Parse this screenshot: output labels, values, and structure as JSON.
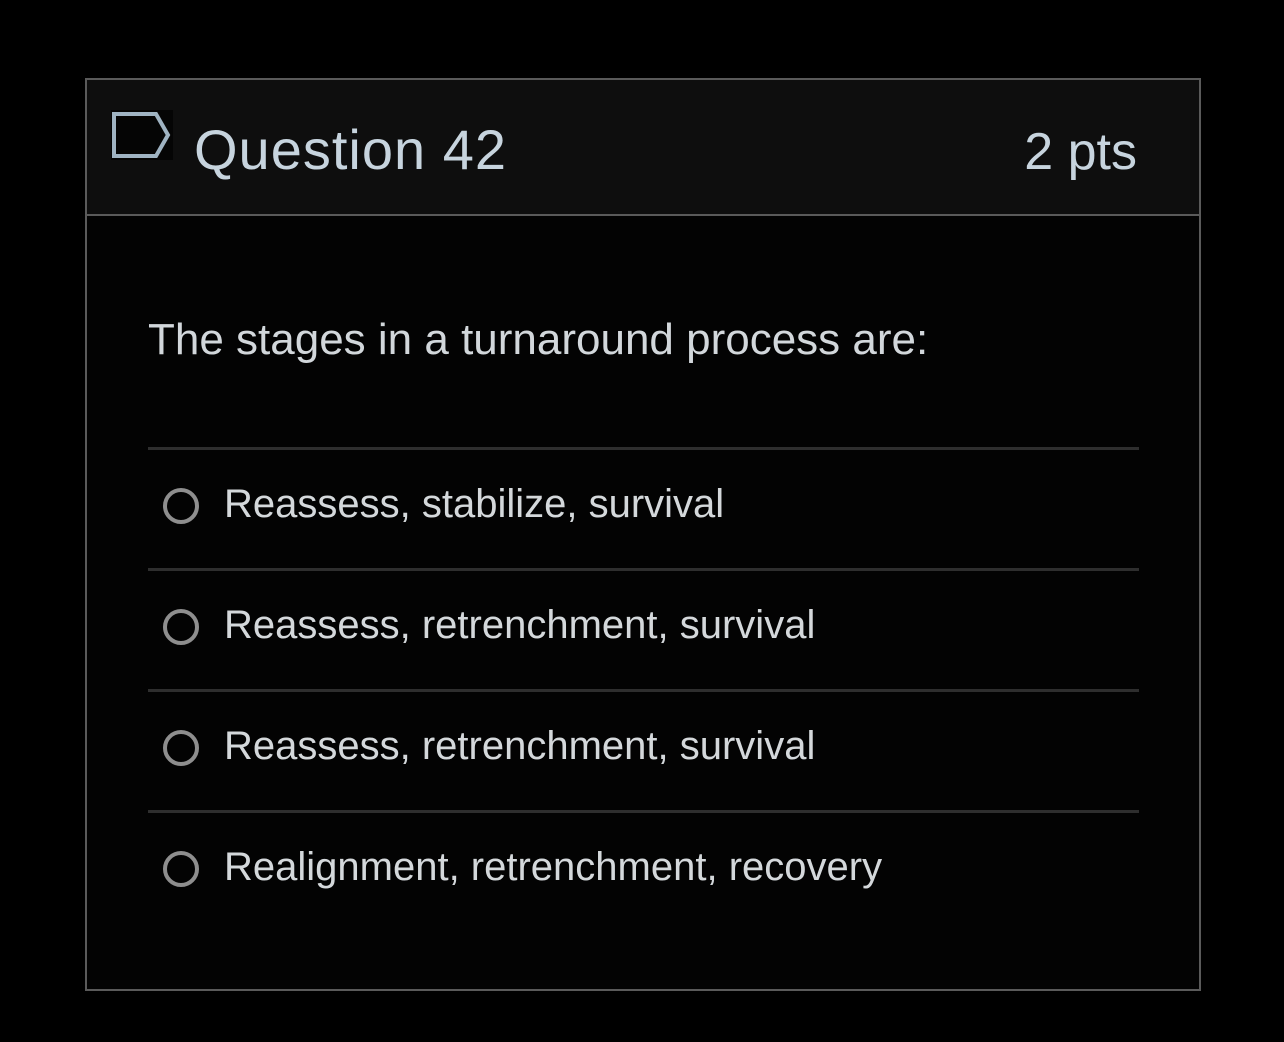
{
  "question": {
    "title": "Question 42",
    "points": "2 pts",
    "flag_icon": "flag-outline-icon",
    "text": "The stages in a turnaround process are:",
    "answers": [
      {
        "label": "Reassess, stabilize, survival",
        "selected": false
      },
      {
        "label": "Reassess, retrenchment, survival",
        "selected": false
      },
      {
        "label": "Reassess, retrenchment, survival",
        "selected": false
      },
      {
        "label": "Realignment, retrenchment, recovery",
        "selected": false
      }
    ]
  },
  "colors": {
    "background": "#000000",
    "header_background": "#0e0e0e",
    "border": "#5a5a5a",
    "title_text": "#c7d4de",
    "body_text": "#d2d7db",
    "radio_border": "#8e8e8e",
    "flag_stroke": "#9fb3c2"
  }
}
